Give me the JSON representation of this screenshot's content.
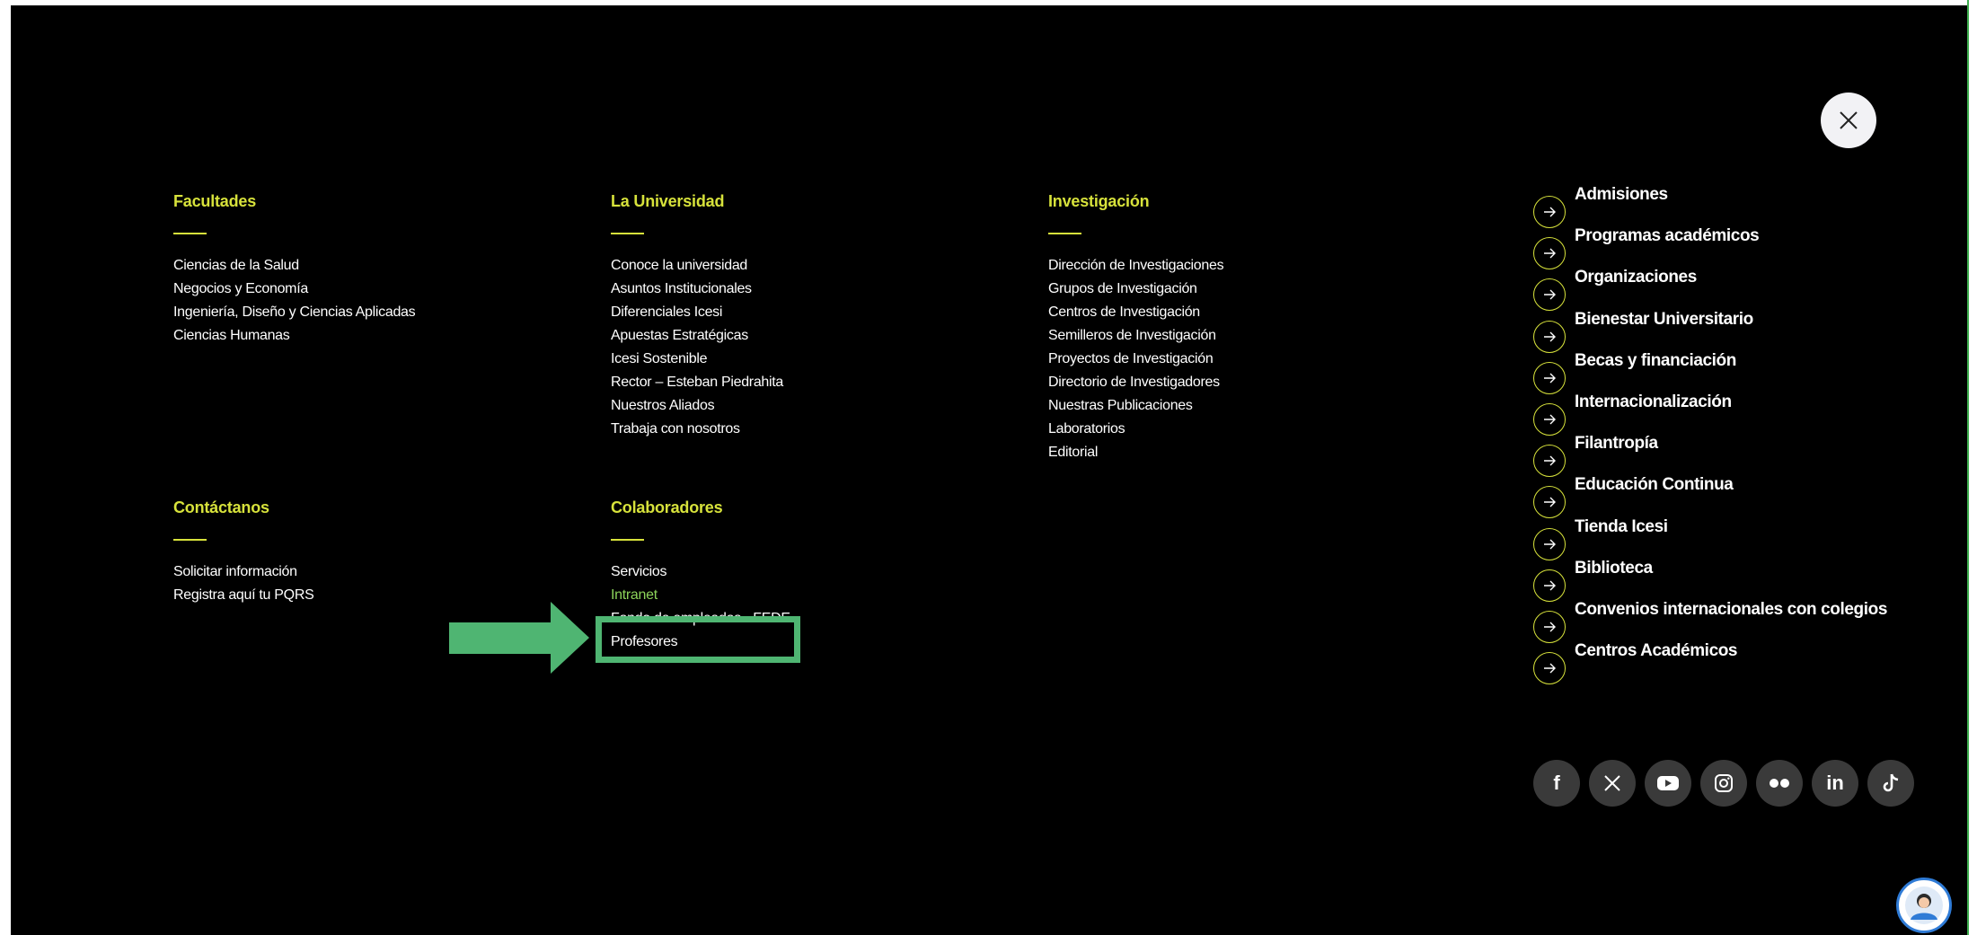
{
  "facultades": {
    "title": "Facultades",
    "links": [
      "Ciencias de la Salud",
      "Negocios y Economía",
      "Ingeniería, Diseño y Ciencias Aplicadas",
      "Ciencias Humanas"
    ]
  },
  "universidad": {
    "title": "La Universidad",
    "links": [
      "Conoce la universidad",
      "Asuntos Institucionales",
      "Diferenciales Icesi",
      "Apuestas Estratégicas",
      "Icesi Sostenible",
      "Rector – Esteban Piedrahita",
      "Nuestros Aliados",
      "Trabaja con nosotros"
    ]
  },
  "investigacion": {
    "title": "Investigación",
    "links": [
      "Dirección de Investigaciones",
      "Grupos de Investigación",
      "Centros de Investigación",
      "Semilleros de Investigación",
      "Proyectos de Investigación",
      "Directorio de Investigadores",
      "Nuestras Publicaciones",
      "Laboratorios",
      "Editorial"
    ]
  },
  "contactanos": {
    "title": "Contáctanos",
    "links": [
      "Solicitar información",
      "Registra aquí tu PQRS"
    ]
  },
  "colaboradores": {
    "title": "Colaboradores",
    "links": [
      "Servicios",
      "Intranet",
      "Fondo de empleados - FEDE",
      "Profesores"
    ],
    "accent_color": "#8cd35a"
  },
  "quick_links": [
    "Admisiones",
    "Programas académicos",
    "Organizaciones",
    "Bienestar Universitario",
    "Becas y financiación",
    "Internacionalización",
    "Filantropía",
    "Educación Continua",
    "Tienda Icesi",
    "Biblioteca",
    "Convenios internacionales con colegios",
    "Centros Académicos"
  ],
  "social_icons": [
    "facebook-icon",
    "x-icon",
    "youtube-icon",
    "instagram-icon",
    "flickr-icon",
    "linkedin-icon",
    "tiktok-icon"
  ],
  "social_labels": {
    "facebook": "f",
    "linkedin": "in"
  },
  "colors": {
    "background": "#000000",
    "accent": "#d7e23b",
    "annotation": "#4fb572"
  }
}
